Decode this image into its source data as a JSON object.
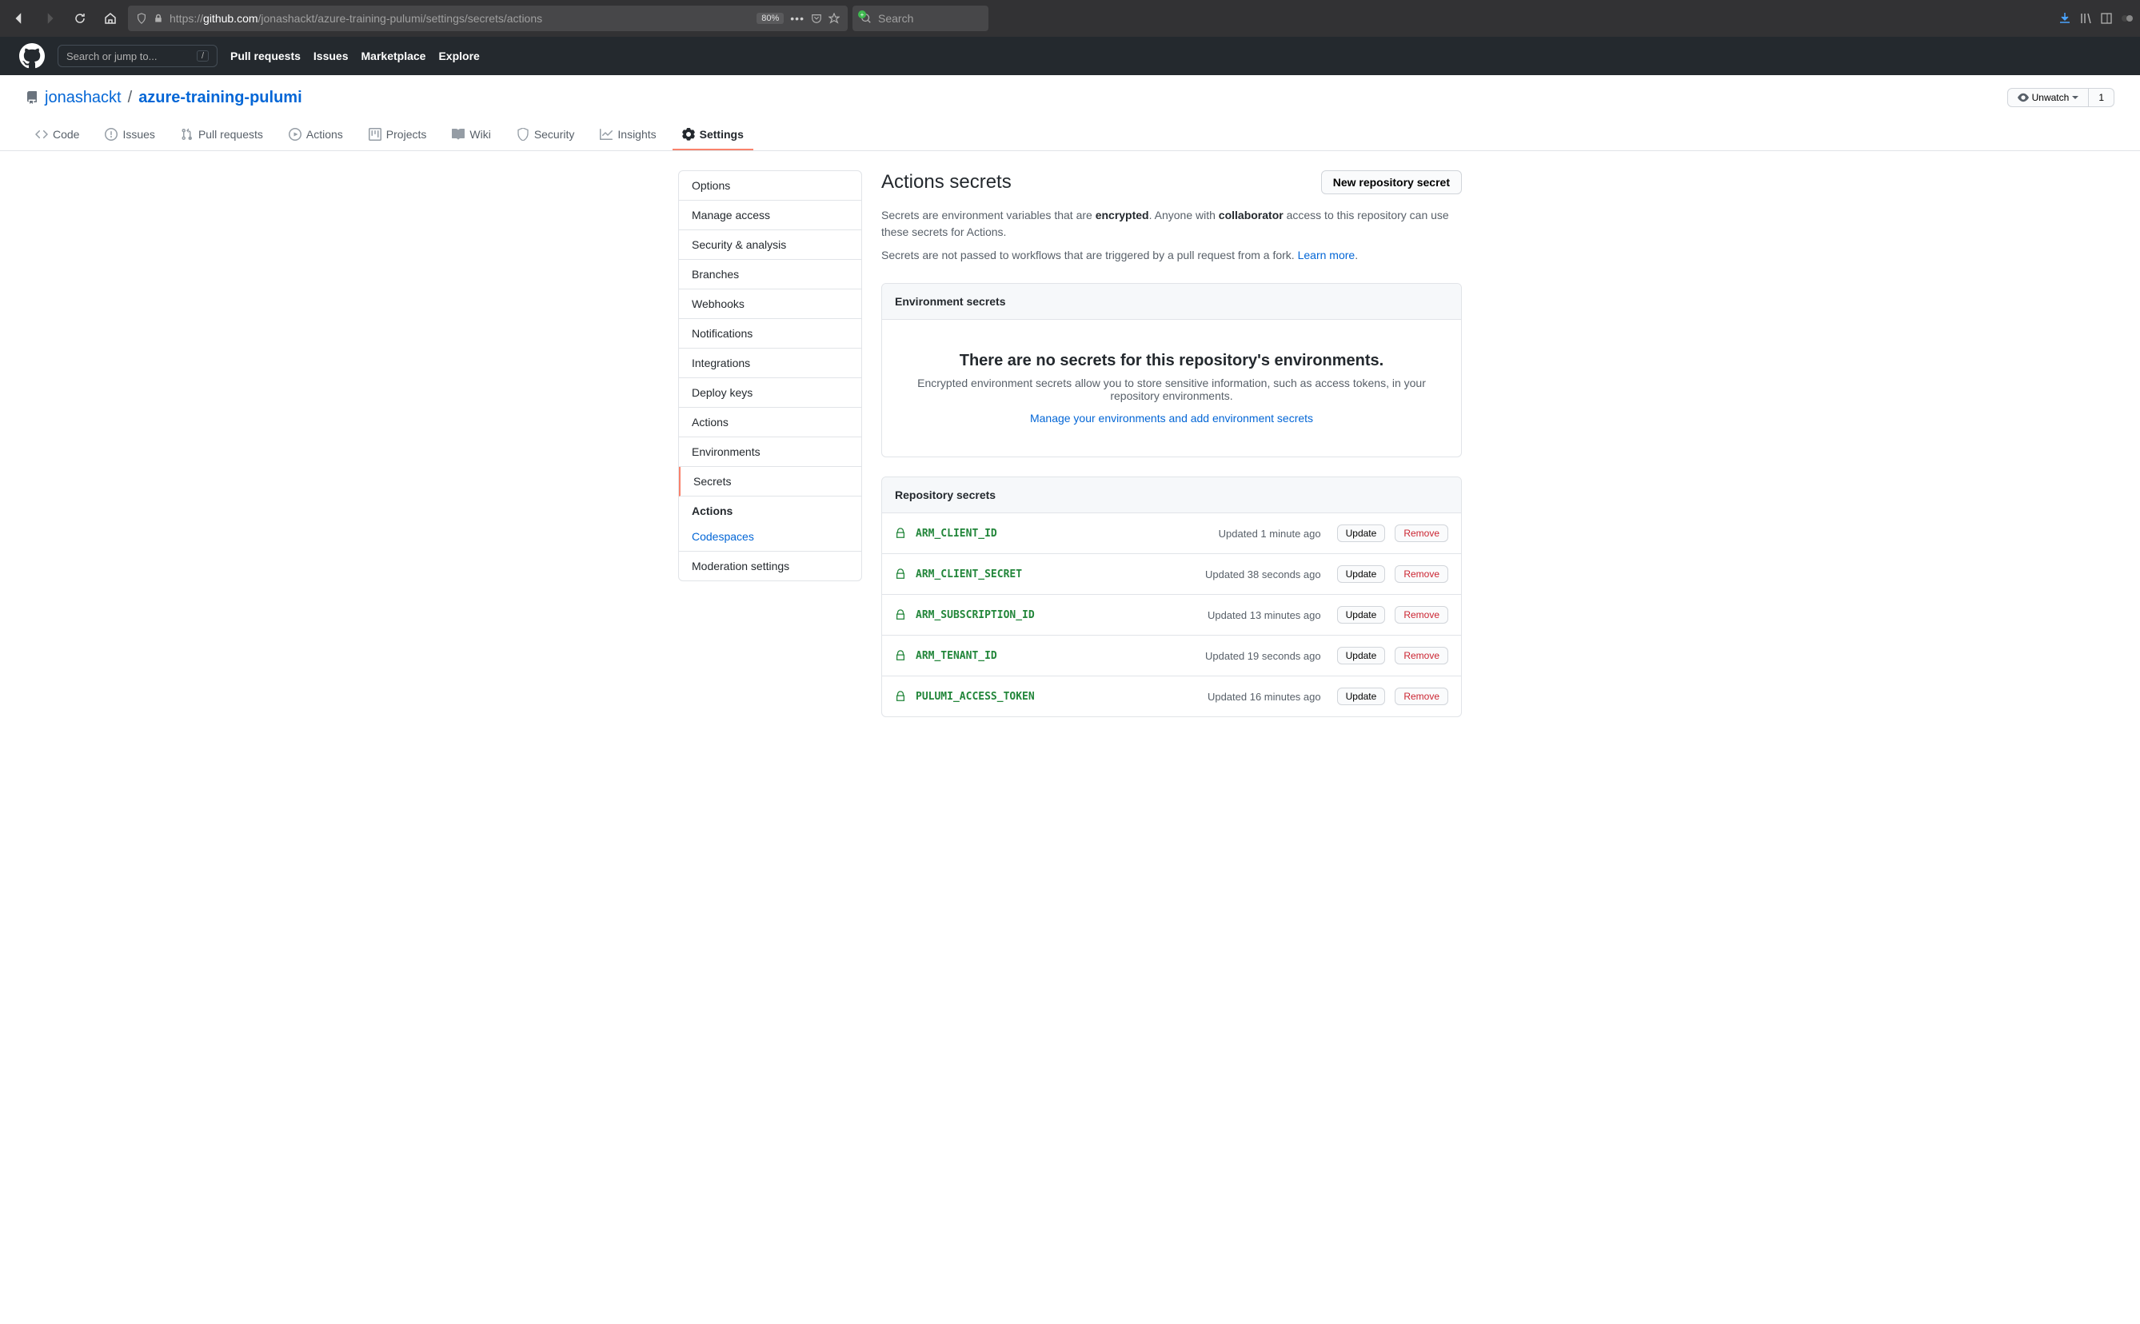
{
  "browser": {
    "url_protocol": "https://",
    "url_host": "github.com",
    "url_path": "/jonashackt/azure-training-pulumi/settings/secrets/actions",
    "zoom": "80%",
    "search_placeholder": "Search"
  },
  "gh_header": {
    "search_placeholder": "Search or jump to...",
    "slash": "/",
    "nav": [
      "Pull requests",
      "Issues",
      "Marketplace",
      "Explore"
    ]
  },
  "repo": {
    "owner": "jonashackt",
    "name": "azure-training-pulumi",
    "unwatch": "Unwatch",
    "watch_count": "1"
  },
  "tabs": [
    "Code",
    "Issues",
    "Pull requests",
    "Actions",
    "Projects",
    "Wiki",
    "Security",
    "Insights",
    "Settings"
  ],
  "sidebar": {
    "items": [
      "Options",
      "Manage access",
      "Security & analysis",
      "Branches",
      "Webhooks",
      "Notifications",
      "Integrations",
      "Deploy keys",
      "Actions",
      "Environments",
      "Secrets"
    ],
    "sub_heading": "Actions",
    "sub_item": "Codespaces",
    "footer": "Moderation settings"
  },
  "content": {
    "title": "Actions secrets",
    "new_btn": "New repository secret",
    "desc1_a": "Secrets are environment variables that are ",
    "desc1_b": "encrypted",
    "desc1_c": ". Anyone with ",
    "desc1_d": "collaborator",
    "desc1_e": " access to this repository can use these secrets for Actions.",
    "desc2_a": "Secrets are not passed to workflows that are triggered by a pull request from a fork. ",
    "desc2_link": "Learn more",
    "env_header": "Environment secrets",
    "env_empty_title": "There are no secrets for this repository's environments.",
    "env_empty_desc": "Encrypted environment secrets allow you to store sensitive information, such as access tokens, in your repository environments.",
    "env_empty_link": "Manage your environments and add environment secrets",
    "repo_header": "Repository secrets",
    "update_btn": "Update",
    "remove_btn": "Remove",
    "secrets": [
      {
        "name": "ARM_CLIENT_ID",
        "updated": "Updated 1 minute ago"
      },
      {
        "name": "ARM_CLIENT_SECRET",
        "updated": "Updated 38 seconds ago"
      },
      {
        "name": "ARM_SUBSCRIPTION_ID",
        "updated": "Updated 13 minutes ago"
      },
      {
        "name": "ARM_TENANT_ID",
        "updated": "Updated 19 seconds ago"
      },
      {
        "name": "PULUMI_ACCESS_TOKEN",
        "updated": "Updated 16 minutes ago"
      }
    ]
  }
}
